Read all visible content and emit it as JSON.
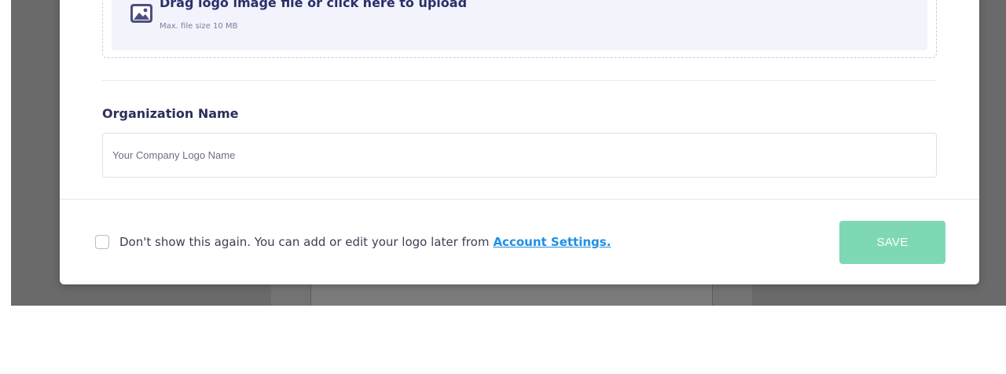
{
  "upload": {
    "title": "Drag logo image file or click here to upload",
    "subtitle": "Max. file size 10 MB",
    "icon": "image-icon"
  },
  "organization": {
    "label": "Organization Name",
    "placeholder": "Your Company Logo Name",
    "value": ""
  },
  "footer": {
    "dont_show_text": "Don't show this again. You can add or edit your logo later from",
    "settings_link": "Account Settings.",
    "save_label": "SAVE",
    "checkbox_checked": false
  },
  "colors": {
    "accent_link": "#1f8fe5",
    "save_button": "#7fd8b4",
    "heading": "#2b2f5a",
    "overlay": "#6a6a6a"
  }
}
